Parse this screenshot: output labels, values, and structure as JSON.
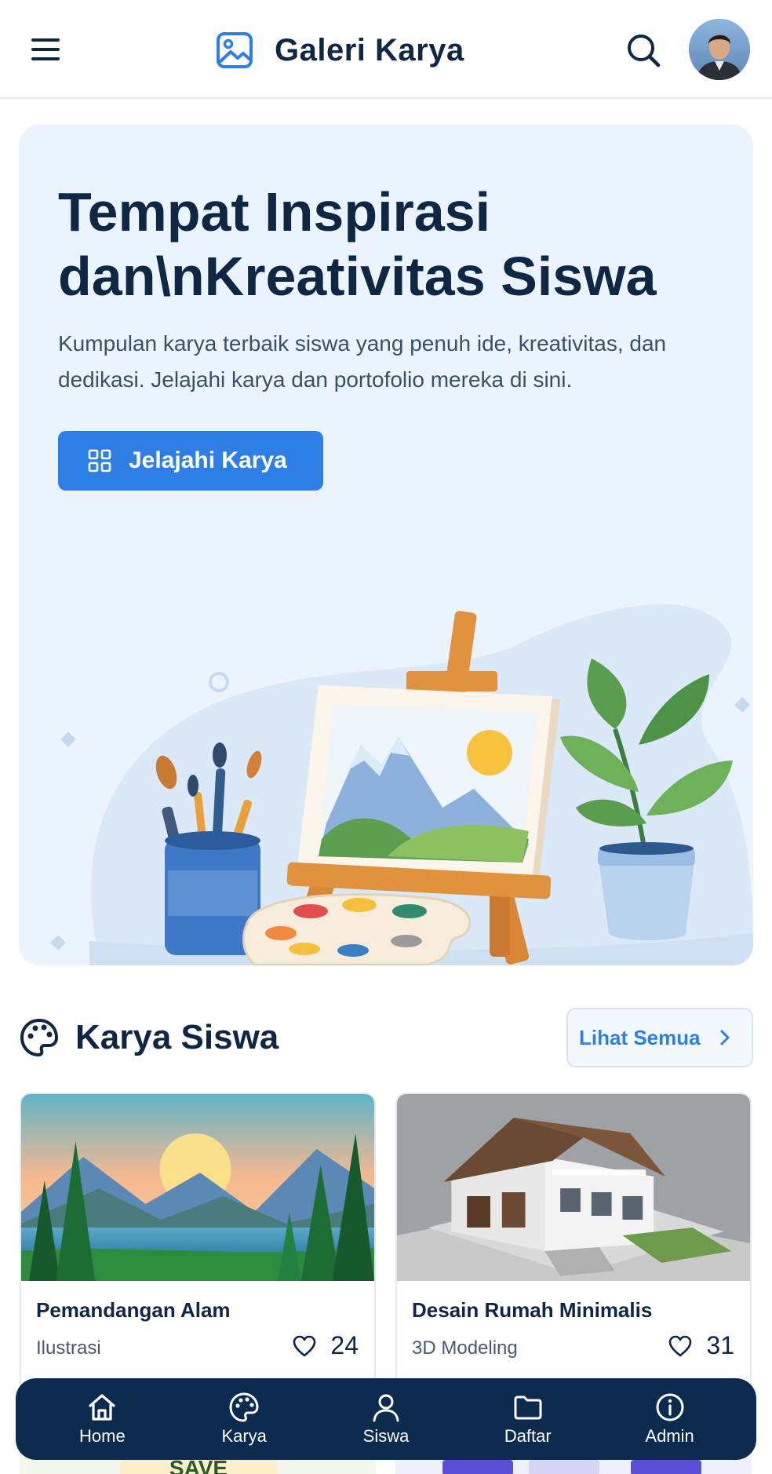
{
  "header": {
    "title": "Galeri Karya",
    "menu_icon": "hamburger-menu-icon",
    "brand_icon": "image-icon",
    "search_icon": "search-icon",
    "accent": "#2f7ee6"
  },
  "hero": {
    "title": "Tempat Inspirasi dan\\nKreativitas Siswa",
    "subtitle": "Kumpulan karya terbaik siswa yang penuh ide, kreativitas, dan dedikasi. Jelajahi karya dan portofolio mereka di sini.",
    "button_label": "Jelajahi Karya",
    "button_icon": "grid-icon",
    "background": "#ebf4fd"
  },
  "section": {
    "title": "Karya Siswa",
    "icon": "palette-icon",
    "see_all_label": "Lihat Semua"
  },
  "cards": [
    {
      "title": "Pemandangan Alam",
      "category": "Ilustrasi",
      "likes": "24"
    },
    {
      "title": "Desain Rumah Minimalis",
      "category": "3D Modeling",
      "likes": "31"
    }
  ],
  "partial_card_text": "SAVE",
  "nav": {
    "background": "#0c2b4e",
    "items": [
      {
        "label": "Home",
        "icon": "home-icon"
      },
      {
        "label": "Karya",
        "icon": "palette-icon"
      },
      {
        "label": "Siswa",
        "icon": "user-icon"
      },
      {
        "label": "Daftar",
        "icon": "folder-icon"
      },
      {
        "label": "Admin",
        "icon": "info-icon"
      }
    ]
  }
}
